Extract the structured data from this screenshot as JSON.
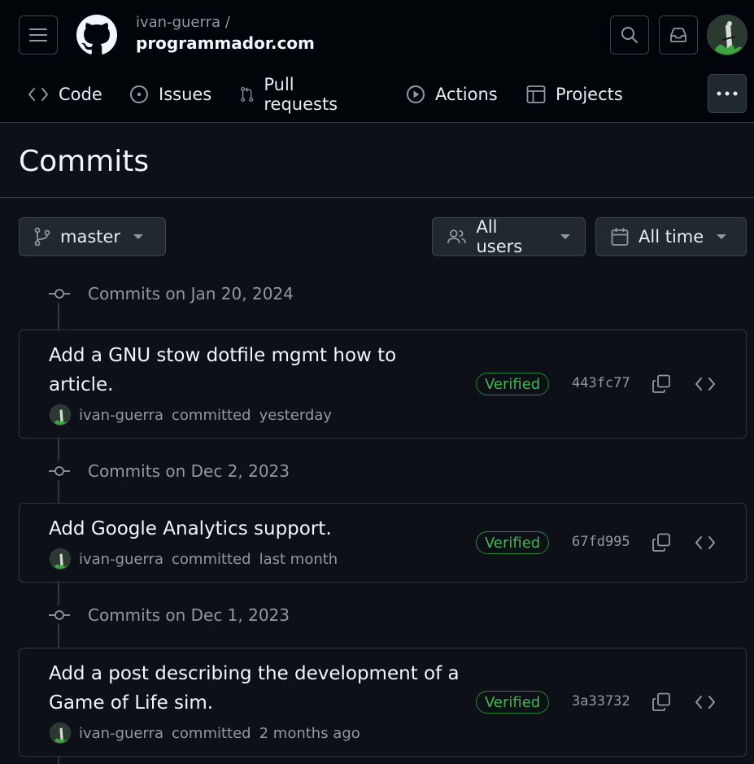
{
  "header": {
    "owner": "ivan-guerra /",
    "repo": "programmador.com"
  },
  "nav": {
    "items": [
      {
        "label": "Code",
        "icon": "code-icon"
      },
      {
        "label": "Issues",
        "icon": "issue-opened-icon"
      },
      {
        "label": "Pull requests",
        "icon": "git-pull-request-icon"
      },
      {
        "label": "Actions",
        "icon": "play-icon"
      },
      {
        "label": "Projects",
        "icon": "table-icon"
      }
    ]
  },
  "page": {
    "title": "Commits"
  },
  "filters": {
    "branch": "master",
    "users": "All users",
    "time": "All time"
  },
  "groups": [
    {
      "date_label": "Commits on Jan 20, 2024",
      "commits": [
        {
          "message_line1": "Add a GNU stow dotfile mgmt how to",
          "message_line2": "article.",
          "author": "ivan-guerra",
          "action": "committed",
          "when": "yesterday",
          "badge": "Verified",
          "sha": "443fc77"
        }
      ]
    },
    {
      "date_label": "Commits on Dec 2, 2023",
      "commits": [
        {
          "message_line1": "Add Google Analytics support.",
          "author": "ivan-guerra",
          "action": "committed",
          "when": "last month",
          "badge": "Verified",
          "sha": "67fd995"
        }
      ]
    },
    {
      "date_label": "Commits on Dec 1, 2023",
      "commits": [
        {
          "message_line1": "Add a post describing the development of a",
          "message_line2": "Game of Life sim.",
          "author": "ivan-guerra",
          "action": "committed",
          "when": "2 months ago",
          "badge": "Verified",
          "sha": "3a33732"
        }
      ]
    }
  ],
  "colors": {
    "background": "#0d1117",
    "header_bg": "#010409",
    "border": "#30363d",
    "verified_green": "#3fb950",
    "muted_text": "#9198a1"
  }
}
